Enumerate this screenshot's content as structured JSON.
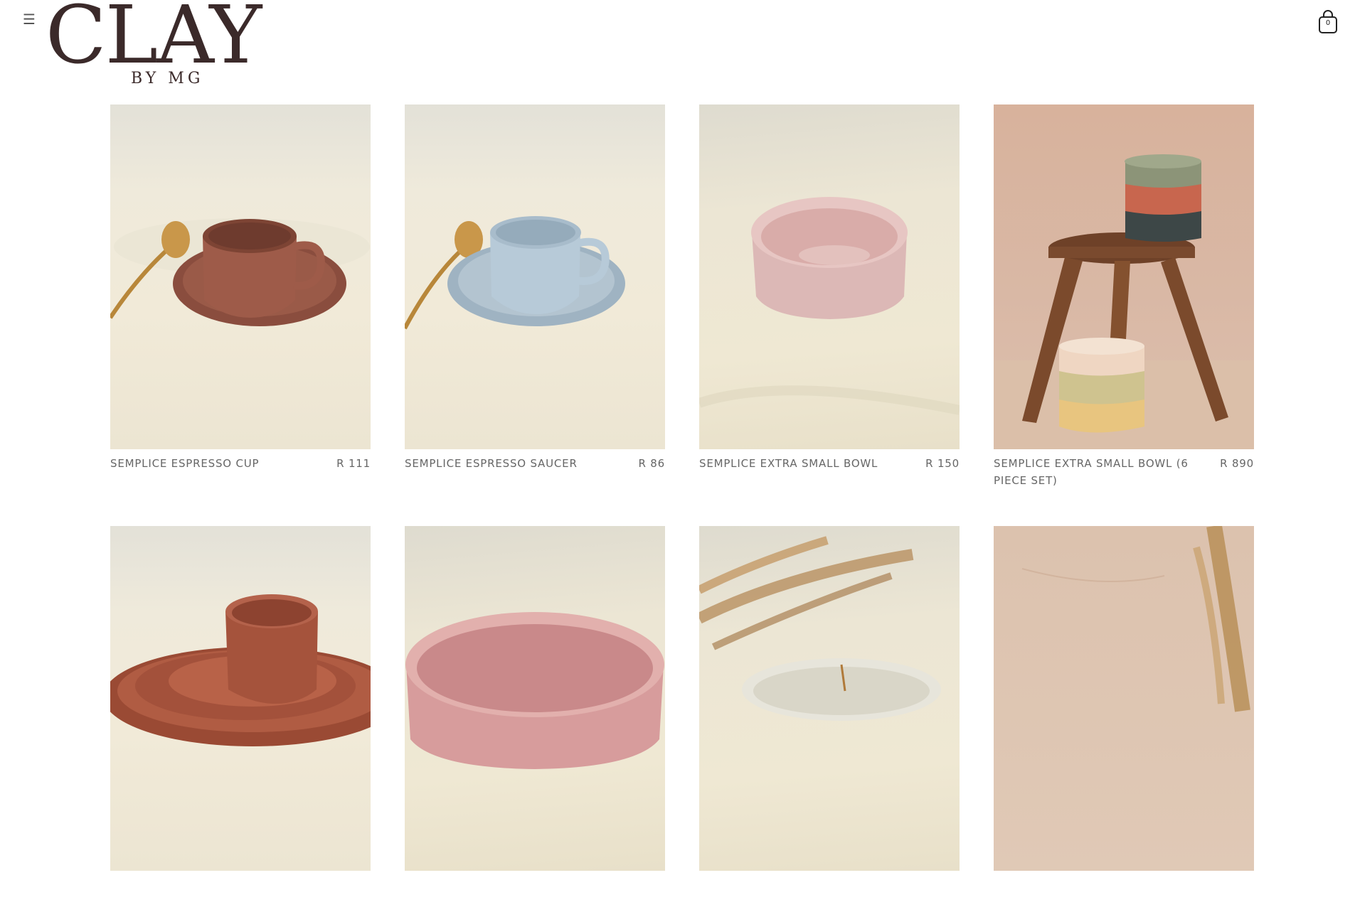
{
  "header": {
    "brand_main": "CLAY",
    "brand_sub": "BY MG",
    "cart_count": "0",
    "menu_icon": "hamburger-menu-icon",
    "cart_icon": "shopping-bag-icon"
  },
  "products": [
    {
      "name": "SEMPLICE ESPRESSO CUP",
      "price": "R 111"
    },
    {
      "name": "SEMPLICE ESPRESSO SAUCER",
      "price": "R 86"
    },
    {
      "name": "SEMPLICE EXTRA SMALL BOWL",
      "price": "R 150"
    },
    {
      "name": "SEMPLICE EXTRA SMALL BOWL (6 PIECE SET)",
      "price": "R 890"
    },
    {
      "name": "",
      "price": ""
    },
    {
      "name": "",
      "price": ""
    },
    {
      "name": "",
      "price": ""
    },
    {
      "name": "",
      "price": ""
    }
  ],
  "colors": {
    "brand": "#3b2a2a",
    "text_muted": "#666666",
    "background": "#ffffff"
  }
}
